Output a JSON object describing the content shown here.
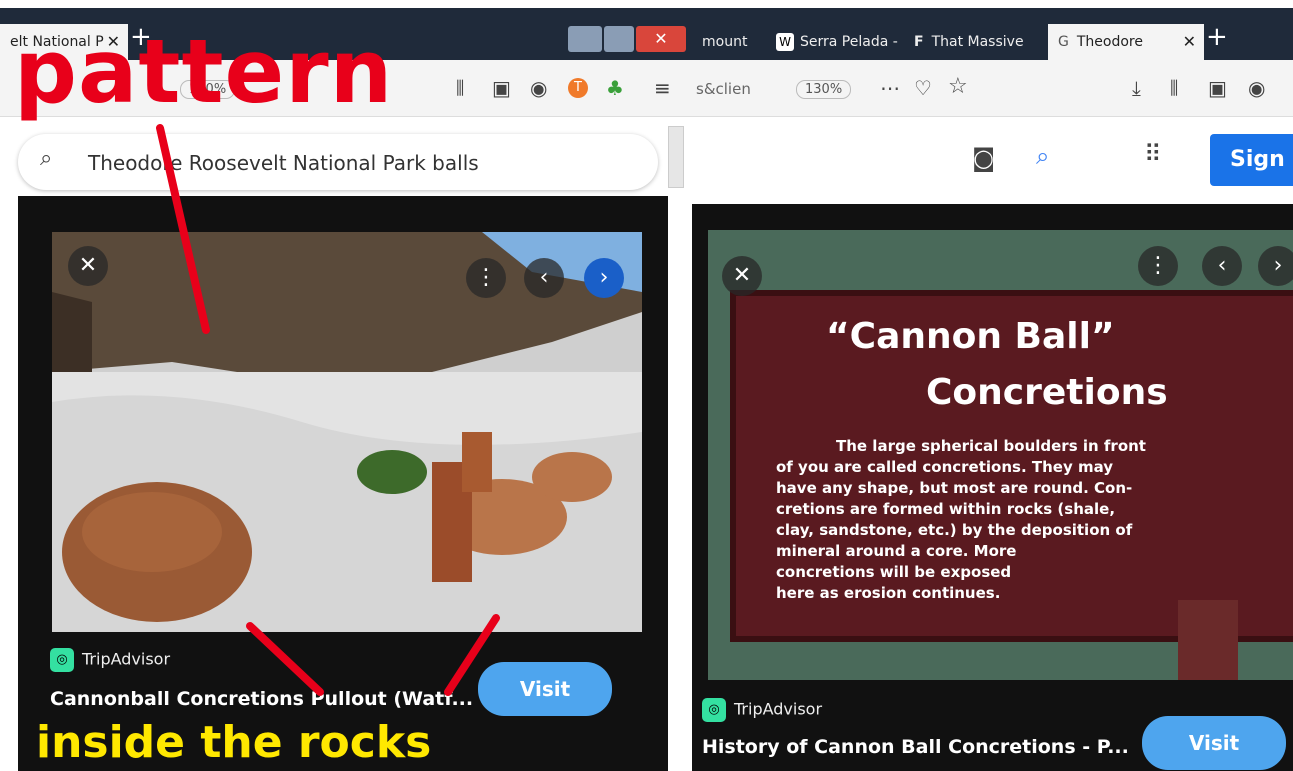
{
  "left": {
    "tabs": {
      "active": "elt National P",
      "new_tab": "+"
    },
    "zoom": "130%",
    "search": {
      "query": "Theodore Roosevelt National Park balls"
    },
    "result": {
      "source": "TripAdvisor",
      "title": "Cannonball Concretions Pullout (Watf...",
      "visit": "Visit"
    }
  },
  "right": {
    "tabs": [
      "mount",
      "Serra Pelada -",
      "That Massive",
      "Theodore"
    ],
    "address_fragment": "s&clien",
    "zoom": "130%",
    "sign_in": "Sign",
    "sign": {
      "title_1": "“Cannon Ball”",
      "title_2": "Concretions",
      "body": [
        "The large spherical boulders in front",
        "of you are called concretions.  They may",
        "have any shape, but most are round.  Con-",
        "cretions are formed within rocks (shale,",
        "clay, sandstone, etc.) by the deposition of",
        "mineral around a core.  More",
        "concretions will be exposed",
        "here as erosion continues."
      ]
    },
    "result": {
      "source": "TripAdvisor",
      "title": "History of Cannon Ball Concretions - P...",
      "visit": "Visit"
    }
  },
  "annotations": {
    "top": "pattern",
    "bottom": "inside the rocks"
  },
  "colors": {
    "annotation_red": "#e8001a",
    "annotation_yellow": "#ffe800",
    "visit_blue": "#4ea5ee",
    "signin_blue": "#1a73e8"
  }
}
